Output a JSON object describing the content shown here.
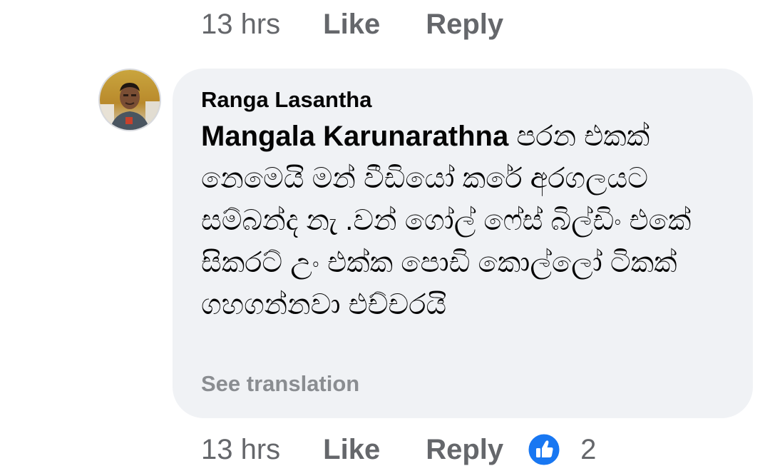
{
  "previous_comment": {
    "timestamp": "13 hrs",
    "like_label": "Like",
    "reply_label": "Reply"
  },
  "comment": {
    "author": "Ranga Lasantha",
    "mention": "Mangala Karunarathna",
    "text": " පරන එකක් නෙමෙයි මන් වීඩියෝ කරේ අරගලයට සම්බන්ද නැ .වන් ගෝල් ෆේස් බිල්ඩිං එකේ සිකරට් උං එක්ක පොඩි කොල්ලෝ ටිකක් ගහගන්නවා එච්චරයි",
    "see_translation": "See translation",
    "timestamp": "13 hrs",
    "like_label": "Like",
    "reply_label": "Reply",
    "reaction_count": "2",
    "reaction_icon": "like-thumbs-up-icon",
    "reaction_color": "#1877f2"
  }
}
